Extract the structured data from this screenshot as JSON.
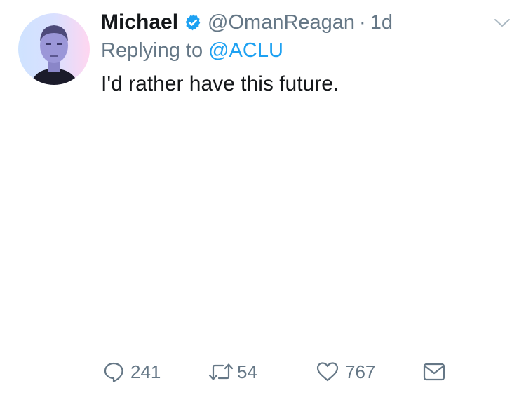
{
  "author": {
    "display_name": "Michael",
    "handle": "@OmanReagan",
    "separator": "·",
    "time": "1d",
    "verified": true,
    "avatar_icon": "profile-photo"
  },
  "reply": {
    "prefix": "Replying to",
    "mention": "@ACLU"
  },
  "tweet": {
    "text": "I'd rather have this future."
  },
  "actions": {
    "reply": {
      "icon": "reply-icon",
      "count": "241"
    },
    "retweet": {
      "icon": "retweet-icon",
      "count": "54"
    },
    "like": {
      "icon": "heart-icon",
      "count": "767"
    },
    "message": {
      "icon": "envelope-icon"
    }
  },
  "colors": {
    "text": "#14171a",
    "secondary": "#657786",
    "link": "#1da1f2",
    "verified": "#1da1f2"
  }
}
